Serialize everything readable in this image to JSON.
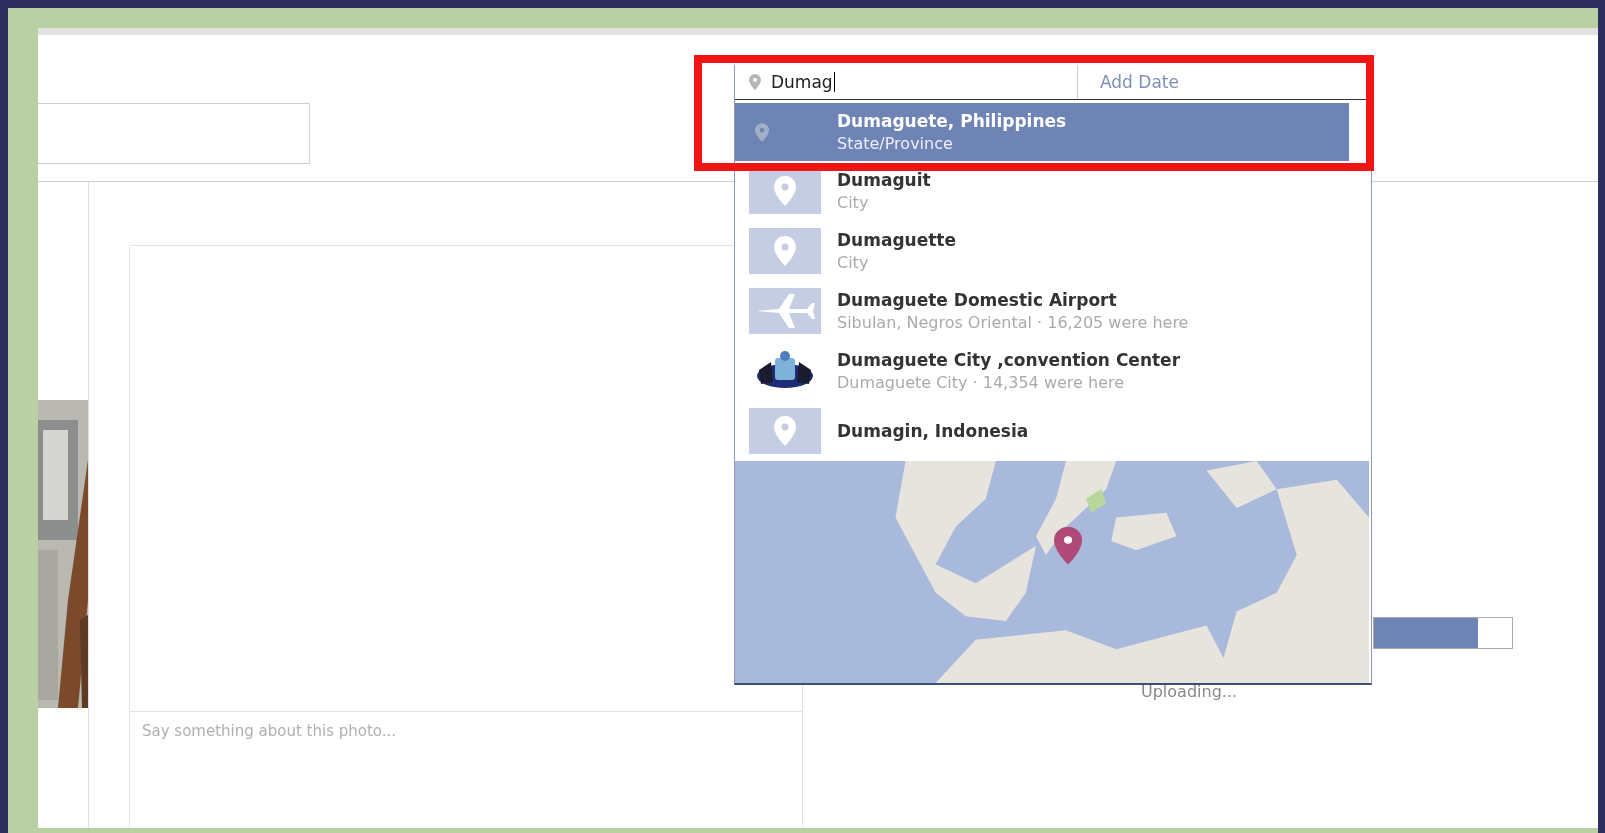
{
  "location_search": {
    "value": "Dumag",
    "date_placeholder": "Add Date"
  },
  "suggestions": [
    {
      "name": "Dumaguete, Philippines",
      "detail": "State/Province",
      "kind": "region",
      "selected": true
    },
    {
      "name": "Dumaguit",
      "detail": "City",
      "kind": "city",
      "selected": false
    },
    {
      "name": "Dumaguette",
      "detail": "City",
      "kind": "city",
      "selected": false
    },
    {
      "name": "Dumaguete Domestic Airport",
      "detail": "Sibulan, Negros Oriental · 16,205 were here",
      "kind": "airport",
      "selected": false
    },
    {
      "name": "Dumaguete City ,convention Center",
      "detail": "Dumaguete City · 14,354 were here",
      "kind": "venue",
      "selected": false
    },
    {
      "name": "Dumagin, Indonesia",
      "kind": "city",
      "selected": false
    }
  ],
  "upload": {
    "level": 0.75,
    "status": "Uploading..."
  },
  "caption": {
    "placeholder": "Say something about this photo..."
  }
}
